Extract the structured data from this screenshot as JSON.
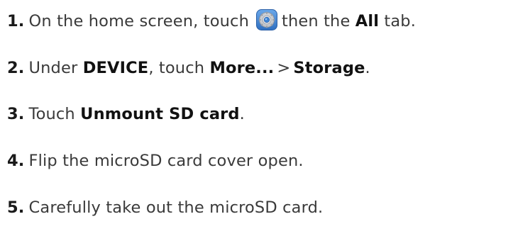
{
  "steps": [
    {
      "number": "1.",
      "before_icon": "On the home screen, touch",
      "icon": "settings-gear-icon",
      "after_icon": "then the",
      "bold": "All",
      "tail": "tab."
    },
    {
      "number": "2.",
      "prefix": "Under",
      "bold_1": "DEVICE",
      "mid": ", touch",
      "bold_2": "More...",
      "separator": ">",
      "bold_3": "Storage",
      "tail": "."
    },
    {
      "number": "3.",
      "prefix": "Touch",
      "bold": "Unmount SD card",
      "tail": "."
    },
    {
      "number": "4.",
      "text": "Flip the microSD card cover open."
    },
    {
      "number": "5.",
      "text": "Carefully take out the microSD card."
    }
  ],
  "colors": {
    "text": "#3a3a3a",
    "bold_text": "#111111",
    "icon_blue": "#4a8fd8",
    "icon_gray": "#c9ccd1"
  }
}
